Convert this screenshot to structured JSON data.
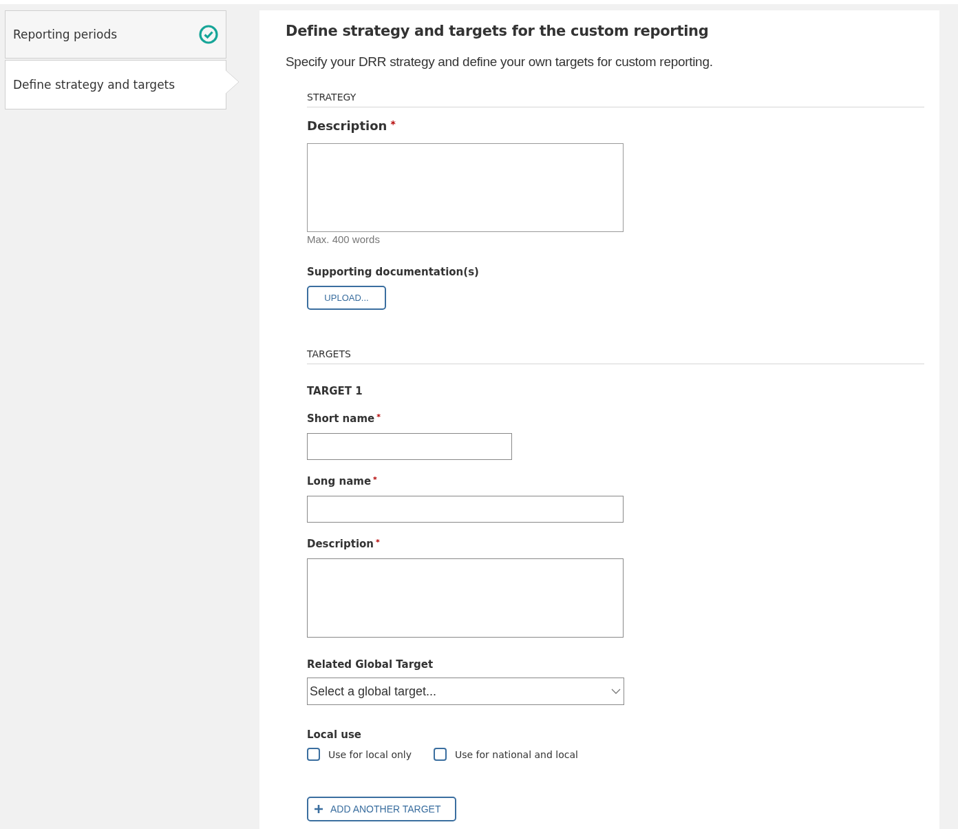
{
  "steps": [
    {
      "label": "Reporting periods",
      "completed": true,
      "selected": false
    },
    {
      "label": "Define strategy and targets",
      "completed": false,
      "selected": true
    }
  ],
  "panel": {
    "title": "Define strategy and targets for the custom reporting",
    "intro": "Specify your DRR strategy and define your own targets for custom reporting.",
    "strategy": {
      "heading": "STRATEGY",
      "description": {
        "label": "Description",
        "required_mark": "*",
        "hint": "Max. 400 words"
      },
      "documents": {
        "label": "Supporting documentation(s)",
        "button": "UPLOAD..."
      }
    },
    "targets": {
      "heading": "TARGETS",
      "items": [
        {
          "title": "TARGET 1",
          "fields": [
            {
              "kind": "short-input",
              "label": "Short name",
              "required_mark": "*"
            },
            {
              "kind": "input",
              "label": "Long name",
              "required_mark": "*"
            },
            {
              "kind": "textarea",
              "label": "Description",
              "required_mark": "*"
            },
            {
              "kind": "select",
              "label": "Related Global Target",
              "placeholder": "Select a global target..."
            },
            {
              "kind": "checkboxes",
              "label": "Local use",
              "options": [
                {
                  "label": "Use for local only",
                  "checked": false
                },
                {
                  "label": "Use for national and local",
                  "checked": false
                }
              ]
            }
          ]
        }
      ],
      "add_button": "ADD ANOTHER TARGET"
    }
  }
}
